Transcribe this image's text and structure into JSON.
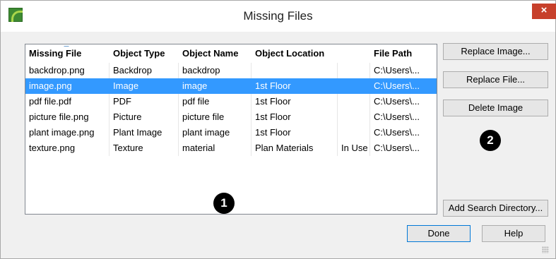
{
  "window": {
    "title": "Missing Files",
    "close_label": "×"
  },
  "table": {
    "columns": [
      "Missing File",
      "Object Type",
      "Object Name",
      "Object Location",
      "",
      "File Path"
    ],
    "rows": [
      [
        "backdrop.png",
        "Backdrop",
        "backdrop",
        "",
        "",
        "C:\\Users\\..."
      ],
      [
        "image.png",
        "Image",
        "image",
        "1st Floor",
        "",
        "C:\\Users\\..."
      ],
      [
        "pdf file.pdf",
        "PDF",
        "pdf file",
        "1st Floor",
        "",
        "C:\\Users\\..."
      ],
      [
        "picture file.png",
        "Picture",
        "picture file",
        "1st Floor",
        "",
        "C:\\Users\\..."
      ],
      [
        "plant image.png",
        "Plant Image",
        "plant image",
        "1st Floor",
        "",
        "C:\\Users\\..."
      ],
      [
        "texture.png",
        "Texture",
        "material",
        "Plan Materials",
        "In Use",
        "C:\\Users\\..."
      ]
    ],
    "selected_row": 1,
    "sort_column": "Missing File"
  },
  "buttons": {
    "replace_image": "Replace Image...",
    "replace_file": "Replace File...",
    "delete_image": "Delete Image",
    "add_search_directory": "Add Search Directory...",
    "done": "Done",
    "help": "Help"
  },
  "callouts": {
    "list": "1",
    "buttons": "2"
  },
  "colors": {
    "selection": "#3399ff",
    "close_button": "#c7402b",
    "app_icon": "#3d8a32"
  }
}
